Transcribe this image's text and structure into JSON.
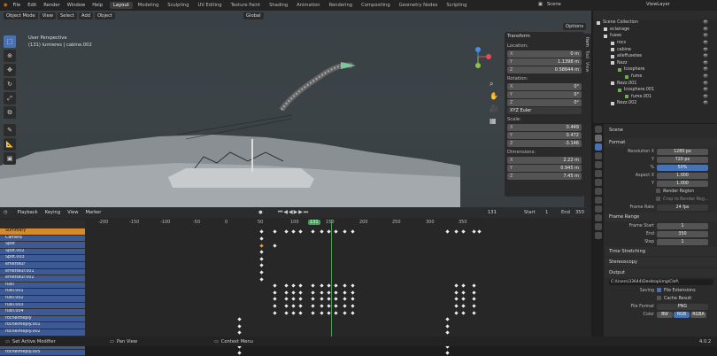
{
  "menus": [
    "File",
    "Edit",
    "Render",
    "Window",
    "Help"
  ],
  "workspaces": [
    "Layout",
    "Modeling",
    "Sculpting",
    "UV Editing",
    "Texture Paint",
    "Shading",
    "Animation",
    "Rendering",
    "Compositing",
    "Geometry Nodes",
    "Scripting"
  ],
  "scene": "Scene",
  "view_layer": "ViewLayer",
  "viewport": {
    "mode": "Object Mode",
    "menus": [
      "View",
      "Select",
      "Add",
      "Object"
    ],
    "transform": "Global",
    "options": "Options",
    "view_name": "User Perspective",
    "collection_info": "(131) lumieres | cabine.002",
    "side_tabs": [
      "Item",
      "Tool",
      "View"
    ]
  },
  "transform": {
    "title": "Transform",
    "location_label": "Location:",
    "location": {
      "x": "0 m",
      "y": "1.1398 m",
      "z": "0.58644 m"
    },
    "rotation_label": "Rotation:",
    "rotation": {
      "x": "0°",
      "y": "0°",
      "z": "0°"
    },
    "rotation_mode": "XYZ Euler",
    "scale_label": "Scale:",
    "scale": {
      "x": "0.449",
      "y": "0.472",
      "z": "-3.146"
    },
    "dimensions_label": "Dimensions:",
    "dimensions": {
      "x": "2.22 m",
      "y": "0.945 m",
      "z": "7.45 m"
    }
  },
  "timeline": {
    "menus": [
      "Playback",
      "Keying",
      "View",
      "Marker"
    ],
    "current_frame": "131",
    "start_label": "Start",
    "start": "1",
    "end_label": "End",
    "end": "350",
    "ruler": [
      "-200",
      "-150",
      "-100",
      "-50",
      "0",
      "50",
      "100",
      "131",
      "150",
      "200",
      "250",
      "300",
      "350"
    ]
  },
  "channels": [
    "Summary",
    "Camera",
    "Spot",
    "Spot.002",
    "Spot.003",
    "emetteur",
    "emetteur.001",
    "emetteur.002",
    "fusil",
    "fusil.001",
    "fusil.002",
    "fusil.003",
    "fusil.004",
    "rochelmeply",
    "rochelmeply.001",
    "rochelmeply.002",
    "rochelmeply.003",
    "rochelmeply.004",
    "rochelmeply.005"
  ],
  "outliner": {
    "items": [
      {
        "label": "Scene Collection",
        "indent": 0
      },
      {
        "label": "eclairage",
        "indent": 1
      },
      {
        "label": "fusee",
        "indent": 1
      },
      {
        "label": "rocs",
        "indent": 2
      },
      {
        "label": "cabine",
        "indent": 2
      },
      {
        "label": "aileffusetee",
        "indent": 2
      },
      {
        "label": "Nezz",
        "indent": 2
      },
      {
        "label": "Icosphere",
        "indent": 3
      },
      {
        "label": "fume",
        "indent": 4
      },
      {
        "label": "Nezz.001",
        "indent": 2
      },
      {
        "label": "Icosphere.001",
        "indent": 3
      },
      {
        "label": "fume.001",
        "indent": 4
      },
      {
        "label": "Nezz.002",
        "indent": 2
      }
    ]
  },
  "properties": {
    "scene": "Scene",
    "format": {
      "title": "Format",
      "res_label": "Resolution X",
      "res_x": "1280 px",
      "y_label": "Y",
      "res_y": "720 px",
      "pct_label": "%",
      "pct": "50%",
      "aspect_label": "Aspect X",
      "aspect_x": "1.000",
      "aspect_y_label": "Y",
      "aspect_y": "1.000",
      "render_region": "Render Region",
      "crop": "Crop to Render Reg...",
      "fps_label": "Frame Rate",
      "fps": "24 fps"
    },
    "frame_range": {
      "title": "Frame Range",
      "start_label": "Frame Start",
      "start": "1",
      "end_label": "End",
      "end": "350",
      "step_label": "Step",
      "step": "1"
    },
    "time_stretching": "Time Stretching",
    "stereoscopy": "Stereoscopy",
    "output": {
      "title": "Output",
      "path": "C:\\Users\\33644\\Desktop\\img\\Clef\\",
      "saving": "Saving",
      "file_ext": "File Extensions",
      "cache": "Cache Result",
      "format_label": "File Format",
      "format": "PNG",
      "color_label": "Color",
      "bw": "BW",
      "rgb": "RGB",
      "rgba": "RGBA"
    }
  },
  "status": {
    "left": "Set Active Modifier",
    "mid": "Pan View",
    "right": "Context Menu",
    "version": "4.0.2"
  }
}
